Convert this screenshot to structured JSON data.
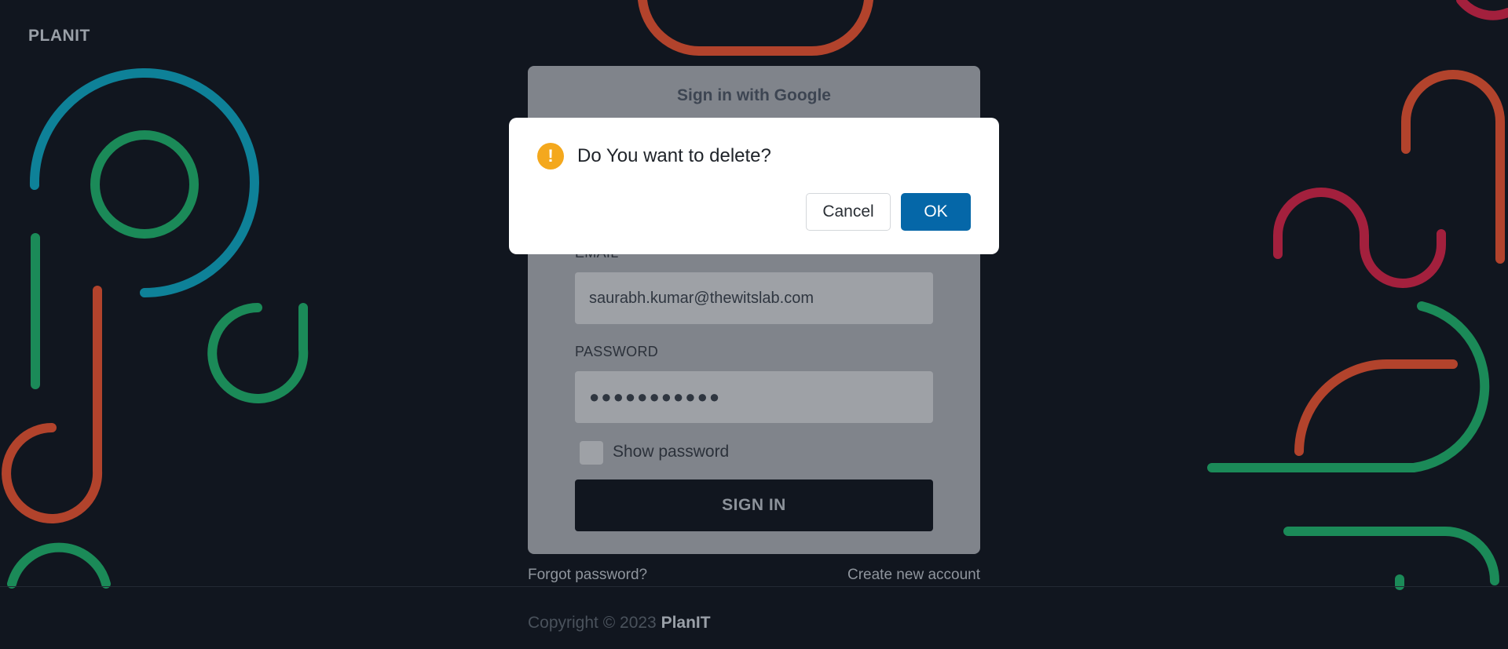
{
  "brand": "PLANIT",
  "login": {
    "google_label": "Sign in with Google",
    "email_label": "EMAIL",
    "email_value": "saurabh.kumar@thewitslab.com",
    "password_label": "PASSWORD",
    "password_value": "●●●●●●●●●●●",
    "show_password_label": "Show password",
    "signin_label": "SIGN IN",
    "forgot_label": "Forgot password?",
    "create_label": "Create new account"
  },
  "footer": {
    "copyright": "Copyright © 2023",
    "brand": "PlanIT"
  },
  "dialog": {
    "icon": "warning-icon",
    "message": "Do You want to delete?",
    "cancel_label": "Cancel",
    "ok_label": "OK"
  },
  "colors": {
    "background": "#11161f",
    "teal": "#0e8198",
    "green": "#1b8a58",
    "orange": "#b2432c",
    "crimson": "#a3203d",
    "primary": "#0567a8",
    "warning": "#f4a81d"
  }
}
